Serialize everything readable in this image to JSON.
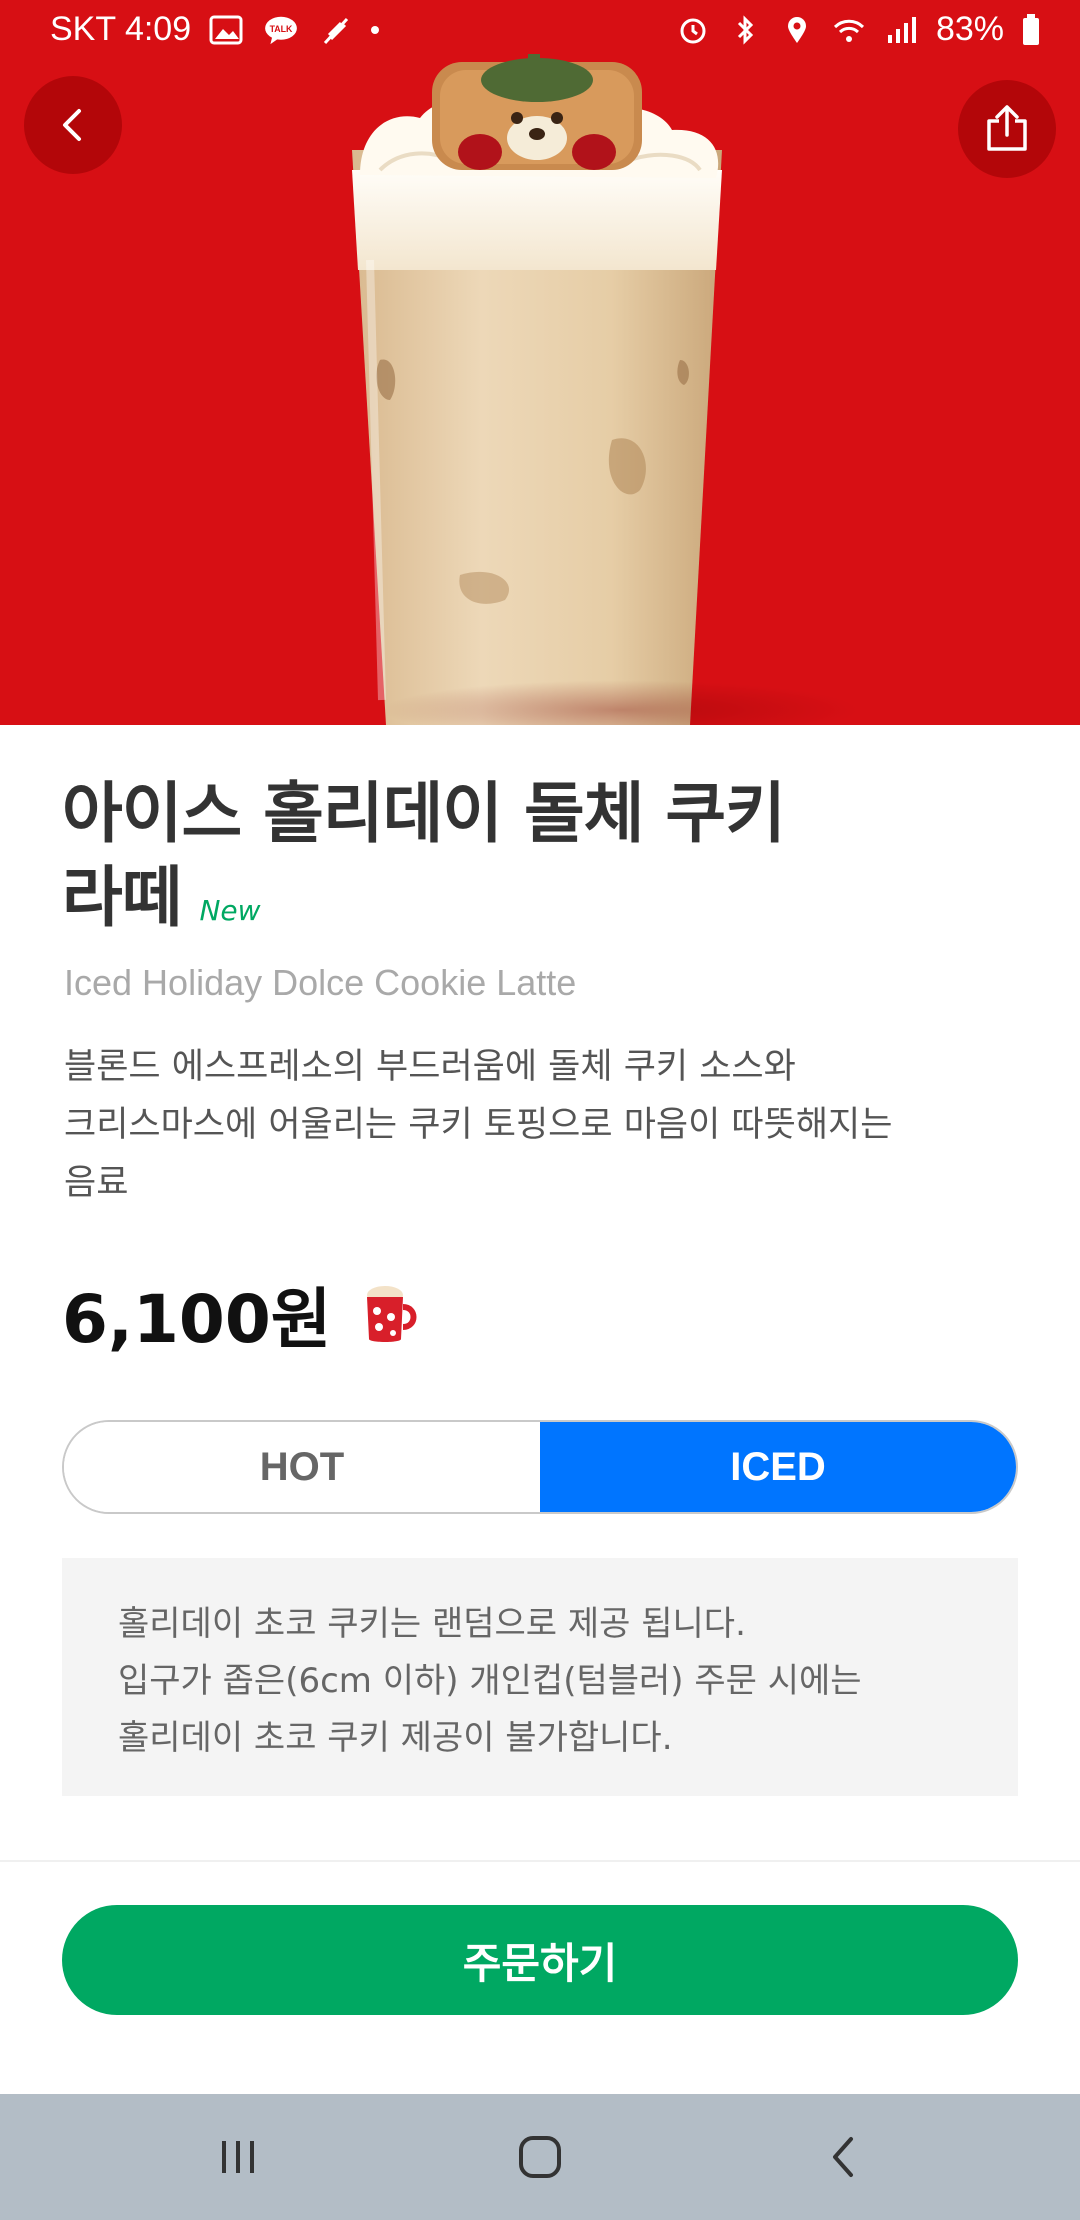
{
  "status_bar": {
    "carrier_time": "SKT 4:09",
    "battery": "83%",
    "talk_badge": "TALK"
  },
  "hero": {
    "background_color": "#d70f14",
    "image": "iced-latte-with-bear-cookie-topping"
  },
  "product": {
    "title_line1": "아이스 홀리데이 돌체 쿠키",
    "title_line2": "라떼",
    "new_label": "New",
    "english_name": "Iced Holiday Dolce Cookie Latte",
    "description_line1": "블론드 에스프레소의 부드러움에 돌체 쿠키 소스와",
    "description_line2": "크리스마스에 어울리는 쿠키 토핑으로 마음이 따뜻해지는",
    "description_line3": "음료",
    "price": "6,100원"
  },
  "temperature_toggle": {
    "hot_label": "HOT",
    "iced_label": "ICED",
    "selected": "ICED"
  },
  "notice": {
    "line1": "홀리데이 초코 쿠키는 랜덤으로 제공 됩니다.",
    "line2": "입구가 좁은(6cm 이하) 개인컵(텀블러) 주문 시에는",
    "line3": "홀리데이 초코 쿠키 제공이 불가합니다."
  },
  "actions": {
    "order_label": "주문하기"
  },
  "colors": {
    "accent_green": "#00a862",
    "selected_blue": "#0075ff",
    "hero_red": "#d70f14"
  },
  "icons": [
    "back-icon",
    "share-icon",
    "mug-icon",
    "recents-icon",
    "home-icon",
    "nav-back-icon"
  ]
}
